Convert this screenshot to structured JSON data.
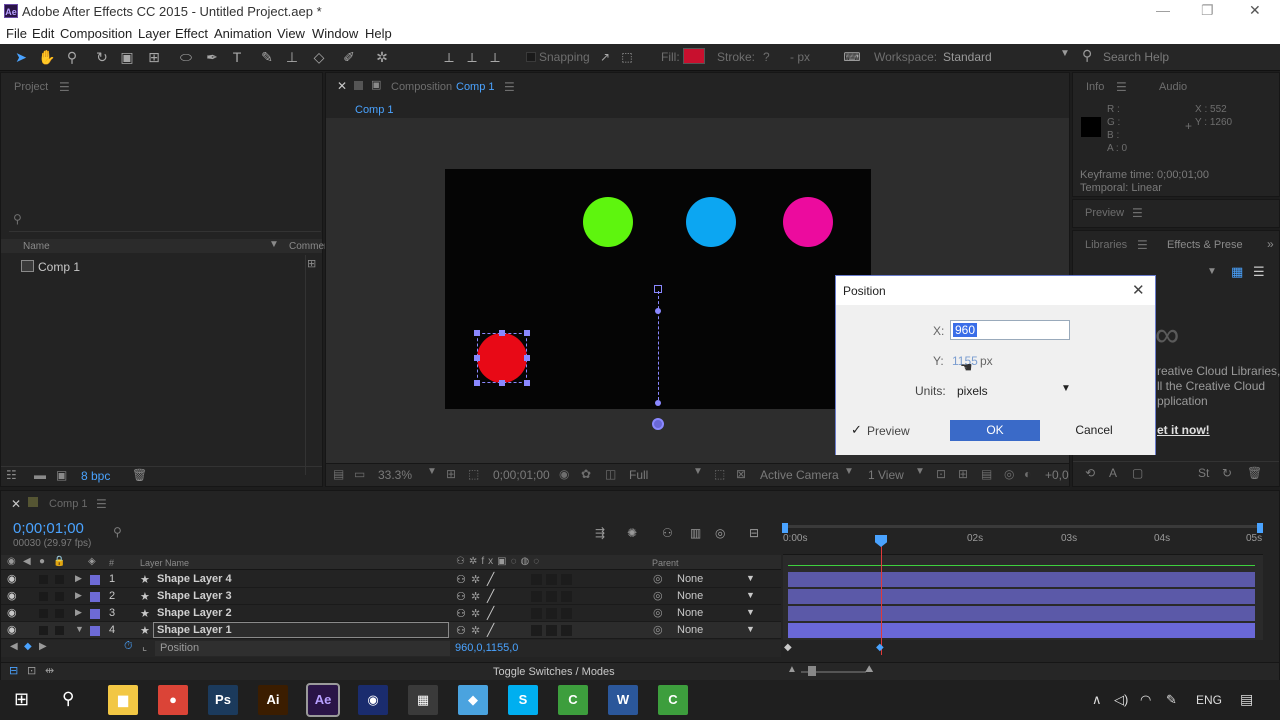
{
  "window": {
    "title": "Adobe After Effects CC 2015 - Untitled Project.aep *",
    "logo": "Ae",
    "controls": [
      "—",
      "❐",
      "✕"
    ]
  },
  "menu": [
    "File",
    "Edit",
    "Composition",
    "Layer",
    "Effect",
    "Animation",
    "View",
    "Window",
    "Help"
  ],
  "toolbar": {
    "snapping": "Snapping",
    "fill_label": "Fill:",
    "fill_color": "#c8102e",
    "stroke_label": "Stroke:",
    "stroke_value": "?",
    "px": "- px",
    "workspace_label": "Workspace:",
    "workspace_value": "Standard",
    "search_placeholder": "Search Help"
  },
  "project": {
    "tab": "Project",
    "col_name": "Name",
    "col_comment": "Commer",
    "items": [
      "Comp 1"
    ],
    "bpc": "8 bpc"
  },
  "composition": {
    "tab_prefix": "Composition",
    "tab_name": "Comp 1",
    "breadcrumb": "Comp 1",
    "zoom": "33.3%",
    "timecode": "0;00;01;00",
    "resolution": "Full",
    "camera": "Active Camera",
    "views": "1 View",
    "exposure": "+0,0",
    "circle_colors": [
      "#5ef50e",
      "#0ca6f2",
      "#ec0b9e",
      "#e80916"
    ]
  },
  "info": {
    "tab": "Info",
    "tab2": "Audio",
    "r": "R :",
    "g": "G :",
    "b": "B :",
    "a": "A : 0",
    "x": "X : 552",
    "y": "Y : 1260",
    "keyframe_time": "Keyframe time: 0;00;01;00",
    "temporal": "Temporal: Linear"
  },
  "preview": {
    "tab": "Preview"
  },
  "libraries": {
    "tab": "Libraries",
    "tab2": "Effects & Prese",
    "line1": "reative Cloud Libraries,",
    "line2": "ll the Creative Cloud",
    "line3": "pplication",
    "link": "et it now!"
  },
  "dialog": {
    "title": "Position",
    "x_label": "X:",
    "x_value": "960",
    "y_label": "Y:",
    "y_value": "1155",
    "y_unit": "px",
    "units_label": "Units:",
    "units_value": "pixels",
    "preview_label": "Preview",
    "preview_checked": true,
    "ok": "OK",
    "cancel": "Cancel"
  },
  "timeline": {
    "tab": "Comp 1",
    "timecode": "0;00;01;00",
    "frames": "00030 (29.97 fps)",
    "col_num": "#",
    "col_layer": "Layer Name",
    "col_parent": "Parent",
    "layers": [
      {
        "num": "1",
        "name": "Shape Layer 4",
        "parent": "None"
      },
      {
        "num": "2",
        "name": "Shape Layer 3",
        "parent": "None"
      },
      {
        "num": "3",
        "name": "Shape Layer 2",
        "parent": "None"
      },
      {
        "num": "4",
        "name": "Shape Layer 1",
        "parent": "None"
      }
    ],
    "prop_name": "Position",
    "prop_value": "960,0,1155,0",
    "ruler": [
      "0:00s",
      "02s",
      "03s",
      "04s",
      "05s"
    ],
    "toggle": "Toggle Switches / Modes",
    "label_color": "#6d6ad6",
    "bar_color": "#5b59a8"
  },
  "taskbar": {
    "apps": [
      {
        "name": "explorer",
        "color": "#f2c744",
        "glyph": "▆"
      },
      {
        "name": "chrome",
        "color": "#db4437",
        "glyph": "●"
      },
      {
        "name": "photoshop",
        "color": "#1b3a5c",
        "glyph": "Ps"
      },
      {
        "name": "illustrator",
        "color": "#3b1d00",
        "glyph": "Ai"
      },
      {
        "name": "after-effects",
        "color": "#2a1447",
        "glyph": "Ae"
      },
      {
        "name": "cinema4d",
        "color": "#1a2c6e",
        "glyph": "◉"
      },
      {
        "name": "calculator",
        "color": "#3a3a3a",
        "glyph": "▦"
      },
      {
        "name": "notes",
        "color": "#4aa3df",
        "glyph": "◆"
      },
      {
        "name": "skype",
        "color": "#00aff0",
        "glyph": "S"
      },
      {
        "name": "camtasia",
        "color": "#3d9e3d",
        "glyph": "C"
      },
      {
        "name": "word",
        "color": "#2b579a",
        "glyph": "W"
      },
      {
        "name": "camtasia-2",
        "color": "#3d9e3d",
        "glyph": "C"
      }
    ],
    "lang": "ENG"
  }
}
